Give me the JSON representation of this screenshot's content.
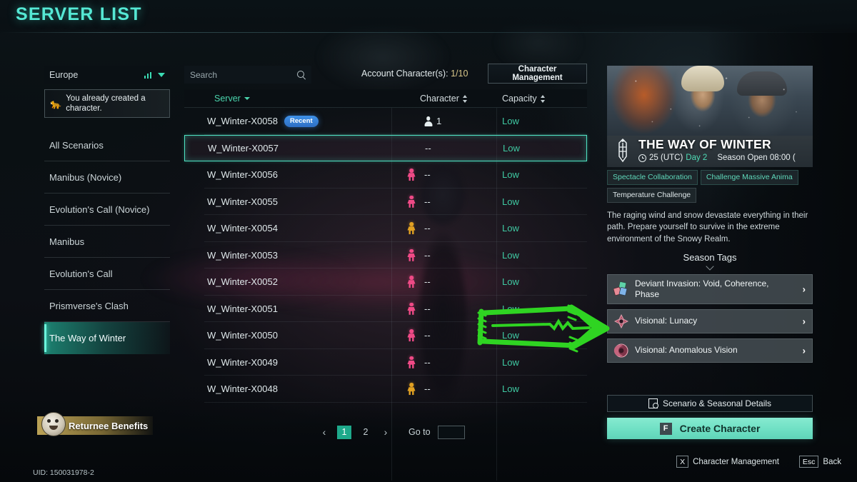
{
  "page": {
    "title": "SERVER LIST"
  },
  "sidebar": {
    "region": {
      "name": "Europe",
      "signal_icon": "signal-bars-icon",
      "chevron_icon": "chevron-down-icon"
    },
    "notice": {
      "icon": "butterfly-icon",
      "text": "You already created a character."
    },
    "scenarios": [
      {
        "label": "All Scenarios",
        "selected": false
      },
      {
        "label": "Manibus (Novice)",
        "selected": false
      },
      {
        "label": "Evolution's Call (Novice)",
        "selected": false
      },
      {
        "label": "Manibus",
        "selected": false
      },
      {
        "label": "Evolution's Call",
        "selected": false
      },
      {
        "label": "Prismverse's Clash",
        "selected": false
      },
      {
        "label": "The Way of Winter",
        "selected": true
      }
    ],
    "returnee": {
      "label": "Returnee Benefits",
      "icon": "panda-avatar-icon"
    },
    "uid": "UID: 150031978-2"
  },
  "center": {
    "search": {
      "placeholder": "Search",
      "value": "",
      "icon": "search-icon"
    },
    "account_characters_label": "Account Character(s):",
    "account_characters_value": "1/10",
    "character_management_button": {
      "line1": "Character",
      "line2": "Management"
    },
    "columns": [
      {
        "key": "server",
        "label": "Server",
        "sort": "desc",
        "active": true
      },
      {
        "key": "character",
        "label": "Character",
        "sort": "both",
        "active": false
      },
      {
        "key": "capacity",
        "label": "Capacity",
        "sort": "both",
        "active": false
      }
    ],
    "rows": [
      {
        "server": "W_Winter-X0058",
        "badge": "Recent",
        "char_icon": "",
        "count": "1",
        "capacity": "Low",
        "selected": false
      },
      {
        "server": "W_Winter-X0057",
        "badge": "",
        "char_icon": "",
        "count": "--",
        "capacity": "Low",
        "selected": true
      },
      {
        "server": "W_Winter-X0056",
        "badge": "",
        "char_icon": "pink",
        "count": "--",
        "capacity": "Low",
        "selected": false
      },
      {
        "server": "W_Winter-X0055",
        "badge": "",
        "char_icon": "pink",
        "count": "--",
        "capacity": "Low",
        "selected": false
      },
      {
        "server": "W_Winter-X0054",
        "badge": "",
        "char_icon": "gold",
        "count": "--",
        "capacity": "Low",
        "selected": false
      },
      {
        "server": "W_Winter-X0053",
        "badge": "",
        "char_icon": "pink",
        "count": "--",
        "capacity": "Low",
        "selected": false
      },
      {
        "server": "W_Winter-X0052",
        "badge": "",
        "char_icon": "pink",
        "count": "--",
        "capacity": "Low",
        "selected": false
      },
      {
        "server": "W_Winter-X0051",
        "badge": "",
        "char_icon": "pink",
        "count": "--",
        "capacity": "Low",
        "selected": false
      },
      {
        "server": "W_Winter-X0050",
        "badge": "",
        "char_icon": "pink",
        "count": "--",
        "capacity": "Low",
        "selected": false
      },
      {
        "server": "W_Winter-X0049",
        "badge": "",
        "char_icon": "pink",
        "count": "--",
        "capacity": "Low",
        "selected": false
      },
      {
        "server": "W_Winter-X0048",
        "badge": "",
        "char_icon": "gold",
        "count": "--",
        "capacity": "Low",
        "selected": false
      }
    ],
    "pagination": {
      "prev_icon": "chevron-left-icon",
      "next_icon": "chevron-right-icon",
      "pages": [
        {
          "label": "1",
          "active": true
        },
        {
          "label": "2",
          "active": false
        }
      ],
      "goto_label": "Go to",
      "goto_value": ""
    }
  },
  "right_panel": {
    "season_title": "THE WAY OF WINTER",
    "season_emblem_icon": "winter-banner-emblem-icon",
    "clock_icon": "clock-icon",
    "season_time": "25 (UTC)",
    "season_day": "Day 2",
    "season_open": "Season Open 08:00 (",
    "chips": [
      {
        "label": "Spectacle Collaboration",
        "style": "accent"
      },
      {
        "label": "Challenge Massive Anima",
        "style": "accent"
      },
      {
        "label": "Temperature Challenge",
        "style": "plain"
      }
    ],
    "description": "The raging wind and snow devastate everything in their path. Prepare yourself to survive in the extreme environment of the Snowy Realm.",
    "season_tags_title": "Season Tags",
    "tags": [
      {
        "label": "Deviant Invasion: Void, Coherence, Phase",
        "icon": "deviant-cards-icon",
        "chevron": "›"
      },
      {
        "label": "Visional: Lunacy",
        "icon": "lunacy-eye-icon",
        "chevron": "›"
      },
      {
        "label": "Visional: Anomalous Vision",
        "icon": "anomalous-vision-icon",
        "chevron": "›"
      }
    ],
    "details_button": {
      "label": "Scenario & Seasonal Details",
      "icon": "document-search-icon"
    },
    "create_button": {
      "key": "F",
      "label": "Create Character"
    }
  },
  "footer": {
    "hints": [
      {
        "key": "X",
        "label": "Character Management"
      },
      {
        "key": "Esc",
        "label": "Back"
      }
    ]
  },
  "annotation": {
    "color": "#2fd422",
    "shape": "hand-drawn-right-arrow"
  }
}
